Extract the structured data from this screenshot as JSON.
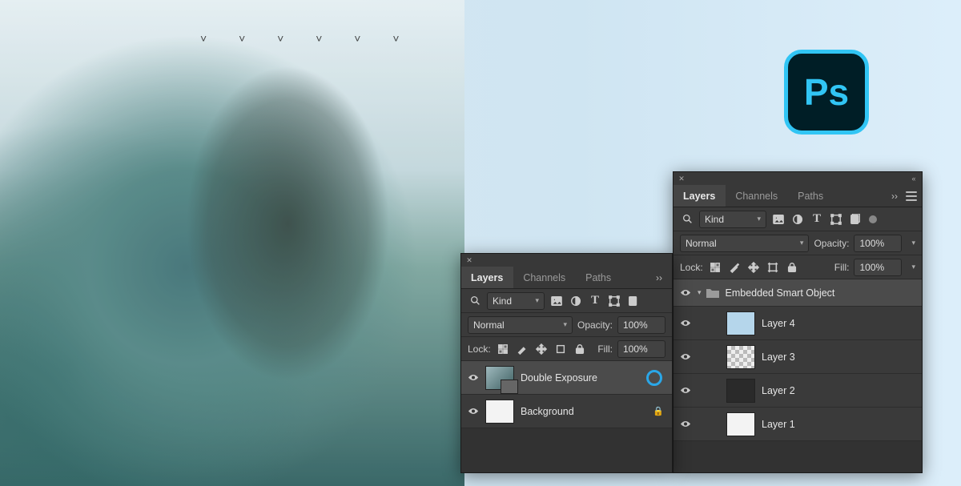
{
  "logo": {
    "text": "Ps"
  },
  "panel_front": {
    "tabs": {
      "layers": "Layers",
      "channels": "Channels",
      "paths": "Paths"
    },
    "filter": {
      "kind_label": "Kind"
    },
    "blend": {
      "mode": "Normal",
      "opacity_label": "Opacity:",
      "opacity_value": "100%"
    },
    "lock": {
      "label": "Lock:",
      "fill_label": "Fill:",
      "fill_value": "100%"
    },
    "layers": {
      "0": {
        "name": "Double Exposure"
      },
      "1": {
        "name": "Background"
      }
    }
  },
  "panel_back": {
    "tabs": {
      "layers": "Layers",
      "channels": "Channels",
      "paths": "Paths"
    },
    "filter": {
      "kind_label": "Kind"
    },
    "blend": {
      "mode": "Normal",
      "opacity_label": "Opacity:",
      "opacity_value": "100%"
    },
    "lock": {
      "label": "Lock:",
      "fill_label": "Fill:",
      "fill_value": "100%"
    },
    "group": {
      "name": "Embedded Smart Object"
    },
    "layers": {
      "0": {
        "name": "Layer 4"
      },
      "1": {
        "name": "Layer 3"
      },
      "2": {
        "name": "Layer 2"
      },
      "3": {
        "name": "Layer 1"
      }
    }
  }
}
